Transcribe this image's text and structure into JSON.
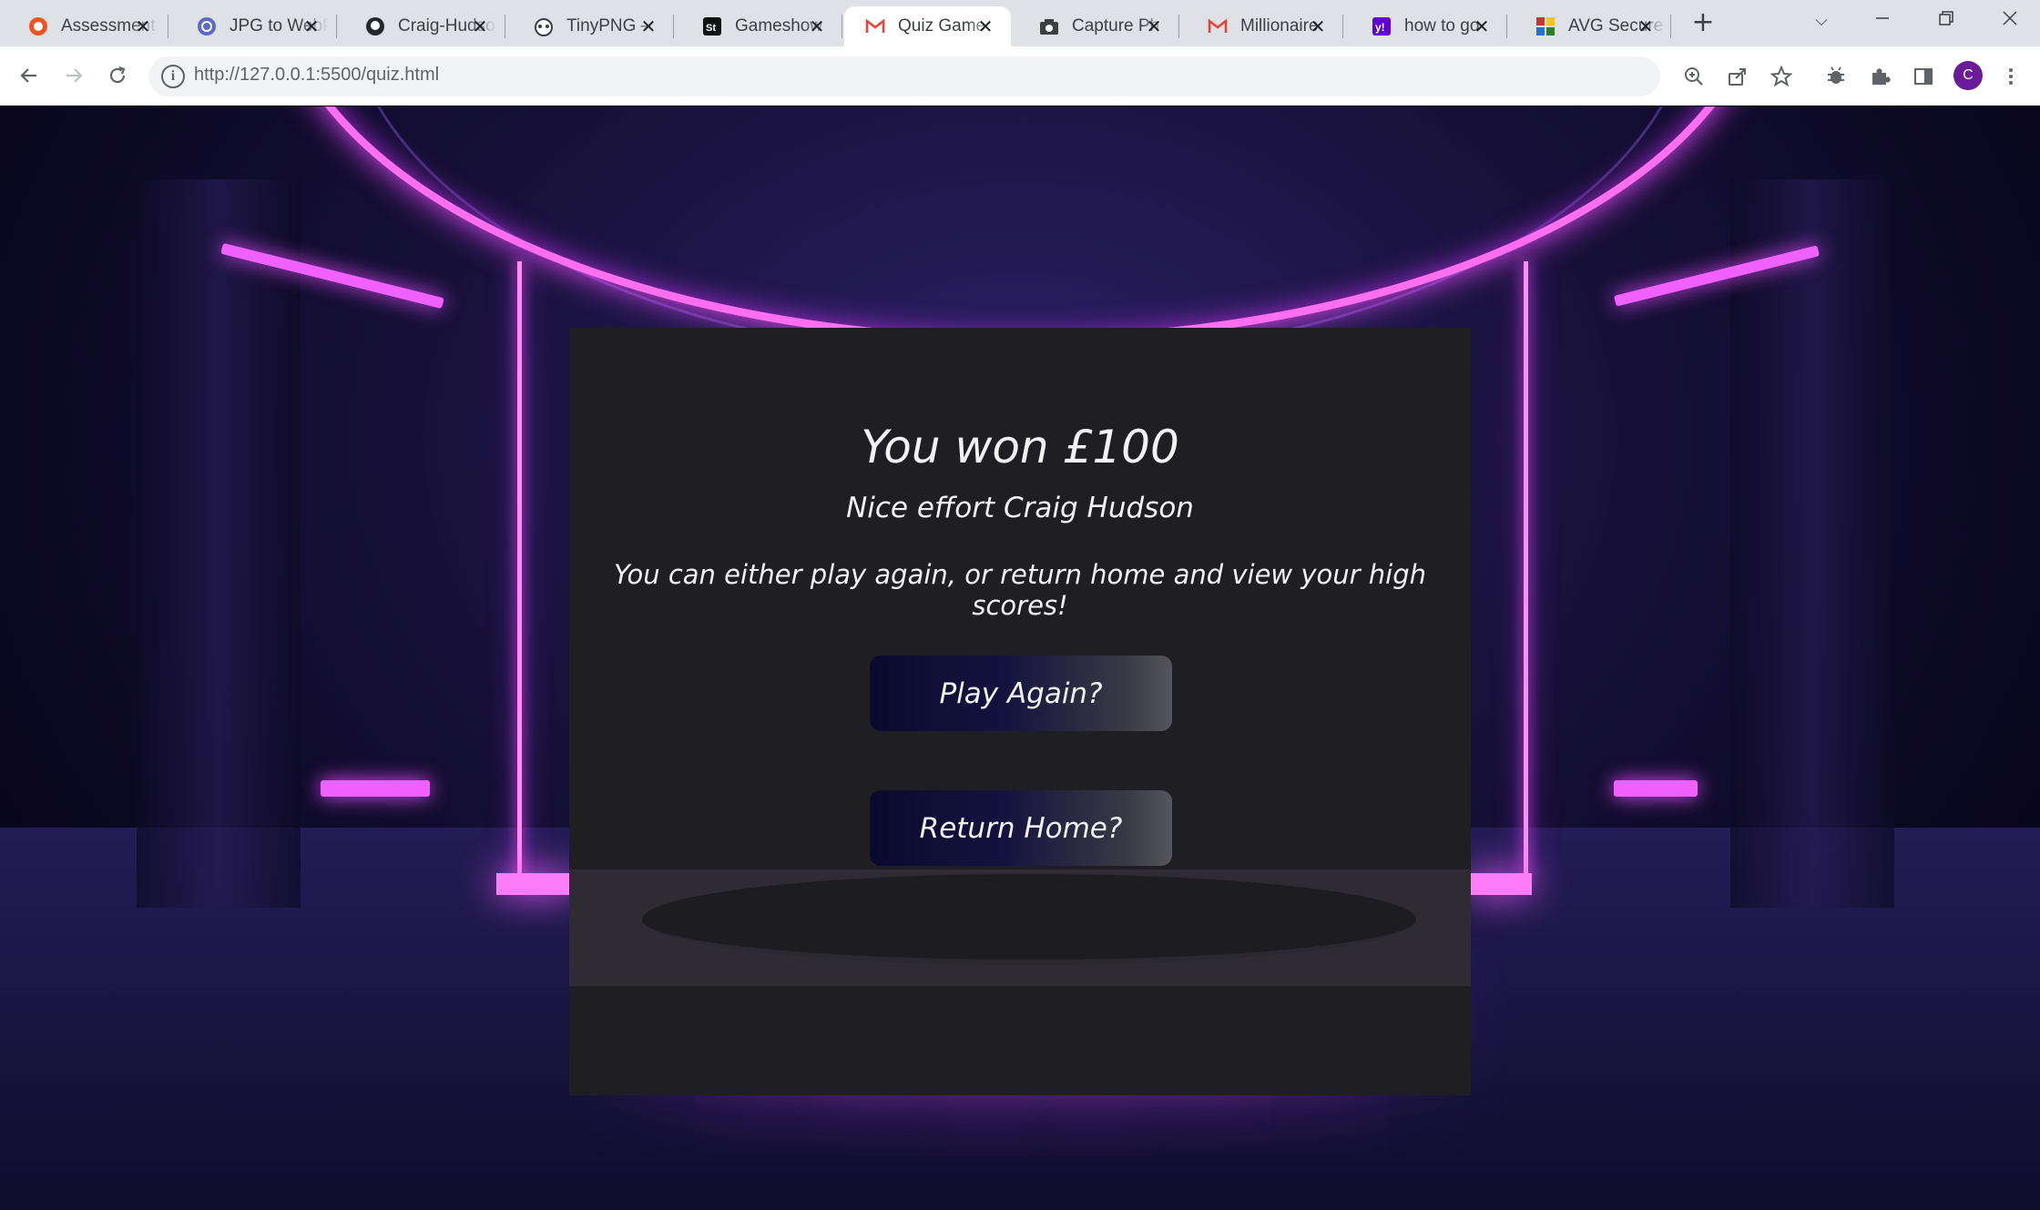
{
  "browser": {
    "tabs": [
      {
        "title": "Assessment",
        "favicon": "assessment-favicon",
        "favicon_color": "#f4511e",
        "active": false
      },
      {
        "title": "JPG to WebP",
        "favicon": "converter-favicon",
        "favicon_color": "#5c6bc0",
        "active": false
      },
      {
        "title": "Craig-Hudson",
        "favicon": "github-favicon",
        "favicon_color": "#24292e",
        "active": false
      },
      {
        "title": "TinyPNG – ",
        "favicon": "panda-favicon",
        "favicon_color": "#3c4043",
        "active": false
      },
      {
        "title": "Gameshow",
        "favicon": "st-favicon",
        "favicon_color": "#111111",
        "active": false
      },
      {
        "title": "Quiz Game",
        "favicon": "gmail-favicon",
        "favicon_color": "#ea4335",
        "active": true
      },
      {
        "title": "Capture Ph",
        "favicon": "camera-favicon",
        "favicon_color": "#3c4043",
        "active": false
      },
      {
        "title": "Millionaire",
        "favicon": "gmail-favicon",
        "favicon_color": "#ea4335",
        "active": false
      },
      {
        "title": "how to go",
        "favicon": "yahoo-favicon",
        "favicon_color": "#6001d2",
        "active": false
      },
      {
        "title": "AVG Secure",
        "favicon": "avg-favicon",
        "favicon_color": "#2e7d32",
        "active": false
      }
    ],
    "url": "http://127.0.0.1:5500/quiz.html",
    "profile_initial": "C",
    "profile_color": "#6a1b9a"
  },
  "quiz": {
    "result_title": "You won £100",
    "player_message": "Nice effort Craig Hudson",
    "instructions": "You can either play again, or return home and view your high scores!",
    "play_again_label": "Play Again?",
    "return_home_label": "Return Home?"
  },
  "theme": {
    "neon_pink": "#ff6ff0",
    "panel_bg": "#1f1e22",
    "button_dark": "#0a0a2e"
  }
}
